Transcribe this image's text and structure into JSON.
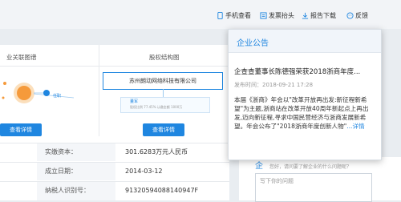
{
  "toolbar": {
    "phone_view": "手机查看",
    "invoice_header": "发票抬头",
    "report_download": "报告下载",
    "feedback": "反馈"
  },
  "sections": {
    "related_graph_title": "业关联图谱",
    "equity_title": "股权结构图",
    "view_detail_1": "查看详情",
    "view_detail_2": "查看详情"
  },
  "graph": {
    "edge_label": "任职"
  },
  "equity": {
    "company_name": "苏州朗动网络科技有限公司",
    "sub_label": "董军",
    "sub_text": "股权比例 77.45%  认缴金额 1000万"
  },
  "info_table": [
    {
      "label": "实缴资本：",
      "value": "301.6283万元人民币"
    },
    {
      "label": "成立日期：",
      "value": "2014-03-12"
    },
    {
      "label": "纳税人识别号：",
      "value": "91320594088140947F"
    }
  ],
  "popup": {
    "header": "企业公告",
    "title": "企查查董事长陈德强荣获2018浙商年度...",
    "time": "发布时间：2018-09-21 17:28",
    "body": "本届《浙商》年会以\"改革开放再出发:新征程新希望\"为主题,浙商站在改革开放40周年新起点上再出发,迈向新征程,寻求中国民营经济与浙商发展新希望。年会公布了\"2018浙商年度创新人物\"",
    "more": "...详情"
  },
  "qa": {
    "hint_text": "您好，请问要了解企业的什么问题呢？",
    "input_placeholder": "写下你的问题"
  }
}
